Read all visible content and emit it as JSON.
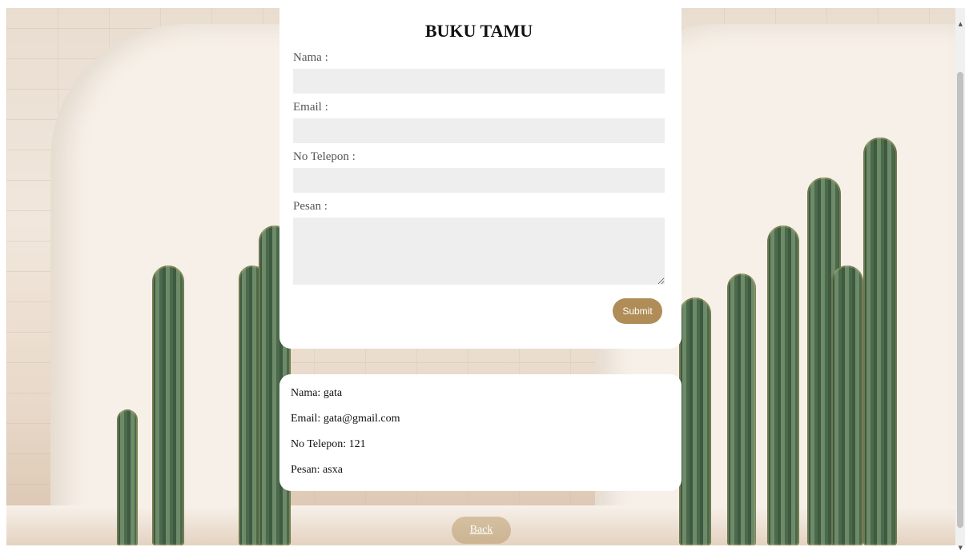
{
  "form": {
    "title": "BUKU TAMU",
    "nama_label": "Nama :",
    "email_label": "Email :",
    "telepon_label": "No Telepon :",
    "pesan_label": "Pesan :",
    "nama_value": "",
    "email_value": "",
    "telepon_value": "",
    "pesan_value": "",
    "submit_label": "Submit"
  },
  "result": {
    "nama": "Nama: gata",
    "email": "Email: gata@gmail.com",
    "telepon": "No Telepon: 121",
    "pesan": "Pesan: asxa"
  },
  "nav": {
    "back_label": "Back"
  },
  "colors": {
    "accent": "#b08d57",
    "field_bg": "#eeeeee"
  }
}
